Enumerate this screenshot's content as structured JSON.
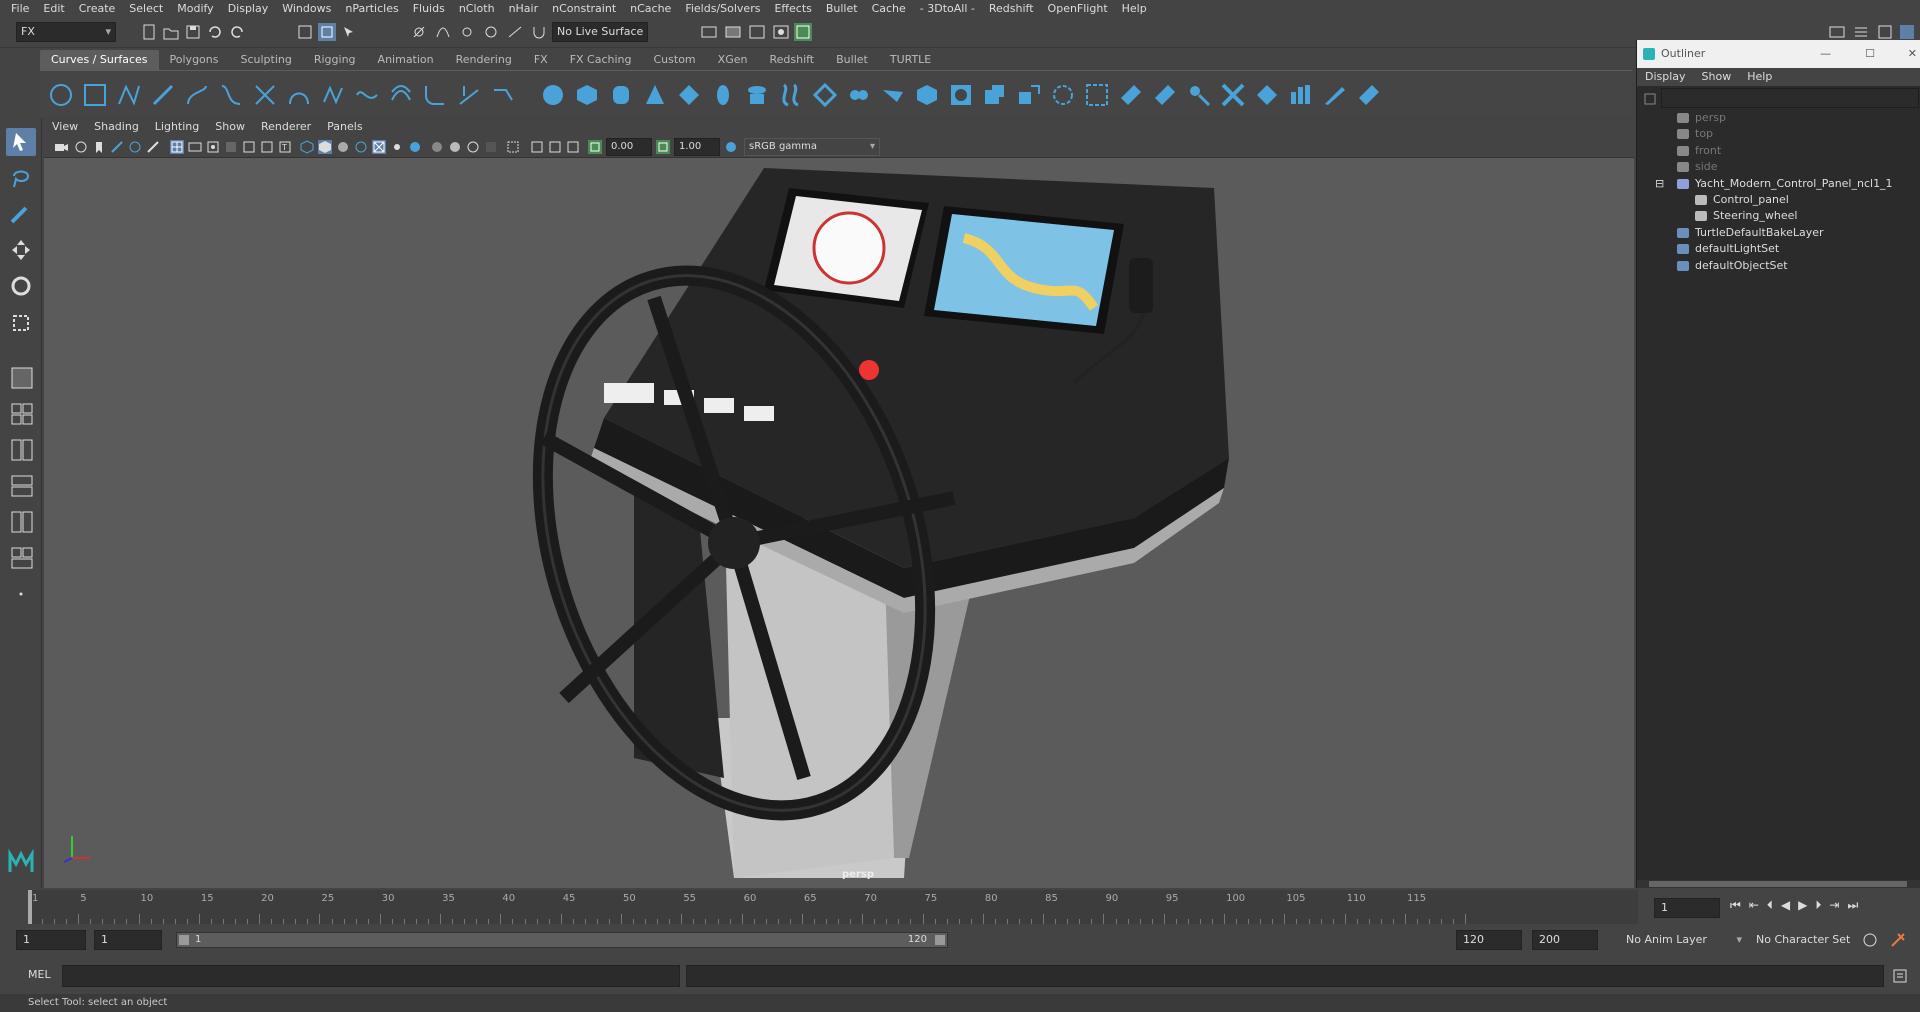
{
  "menubar": [
    "File",
    "Edit",
    "Create",
    "Select",
    "Modify",
    "Display",
    "Windows",
    "nParticles",
    "Fluids",
    "nCloth",
    "nHair",
    "nConstraint",
    "nCache",
    "Fields/Solvers",
    "Effects",
    "Bullet",
    "Cache",
    "- 3DtoAll -",
    "Redshift",
    "OpenFlight",
    "Help"
  ],
  "statusline": {
    "menuset": "FX",
    "live_surface": "No Live Surface"
  },
  "shelf_tabs": [
    "Curves / Surfaces",
    "Polygons",
    "Sculpting",
    "Rigging",
    "Animation",
    "Rendering",
    "FX",
    "FX Caching",
    "Custom",
    "XGen",
    "Redshift",
    "Bullet",
    "TURTLE"
  ],
  "panel_menu": [
    "View",
    "Shading",
    "Lighting",
    "Show",
    "Renderer",
    "Panels"
  ],
  "panel_toolbar": {
    "exposure": "0.00",
    "gamma": "1.00",
    "color_space": "sRGB gamma"
  },
  "viewport": {
    "camera_label": "persp"
  },
  "outliner": {
    "title": "Outliner",
    "menu": [
      "Display",
      "Show",
      "Help"
    ],
    "items": [
      {
        "label": "persp",
        "indent": 0,
        "dim": true,
        "icon": "camera-icon"
      },
      {
        "label": "top",
        "indent": 0,
        "dim": true,
        "icon": "camera-icon"
      },
      {
        "label": "front",
        "indent": 0,
        "dim": true,
        "icon": "camera-icon"
      },
      {
        "label": "side",
        "indent": 0,
        "dim": true,
        "icon": "camera-icon"
      },
      {
        "label": "Yacht_Modern_Control_Panel_ncl1_1",
        "indent": 0,
        "dim": false,
        "icon": "group-icon",
        "expanded": true
      },
      {
        "label": "Control_panel",
        "indent": 1,
        "dim": false,
        "icon": "mesh-icon"
      },
      {
        "label": "Steering_wheel",
        "indent": 1,
        "dim": false,
        "icon": "mesh-icon"
      },
      {
        "label": "TurtleDefaultBakeLayer",
        "indent": 0,
        "dim": false,
        "icon": "bakelayer-icon"
      },
      {
        "label": "defaultLightSet",
        "indent": 0,
        "dim": false,
        "icon": "set-icon"
      },
      {
        "label": "defaultObjectSet",
        "indent": 0,
        "dim": false,
        "icon": "set-icon"
      }
    ]
  },
  "timeline": {
    "ticks": [
      "1",
      "5",
      "10",
      "15",
      "20",
      "25",
      "30",
      "35",
      "40",
      "45",
      "50",
      "55",
      "60",
      "65",
      "70",
      "75",
      "80",
      "85",
      "90",
      "95",
      "100",
      "105",
      "110",
      "115"
    ],
    "current_frame": "1"
  },
  "range": {
    "start": "1",
    "playback_start": "1",
    "range_start": "1",
    "range_end": "120",
    "playback_end": "120",
    "end": "200",
    "anim_layer": "No Anim Layer",
    "character_set": "No Character Set"
  },
  "command": {
    "language": "MEL"
  },
  "status": {
    "help_text": "Select Tool: select an object"
  },
  "colors": {
    "accent": "#5d7fa8",
    "shelf_icon": "#4aa3d8",
    "viewport_bg": "#5b5b5b"
  }
}
